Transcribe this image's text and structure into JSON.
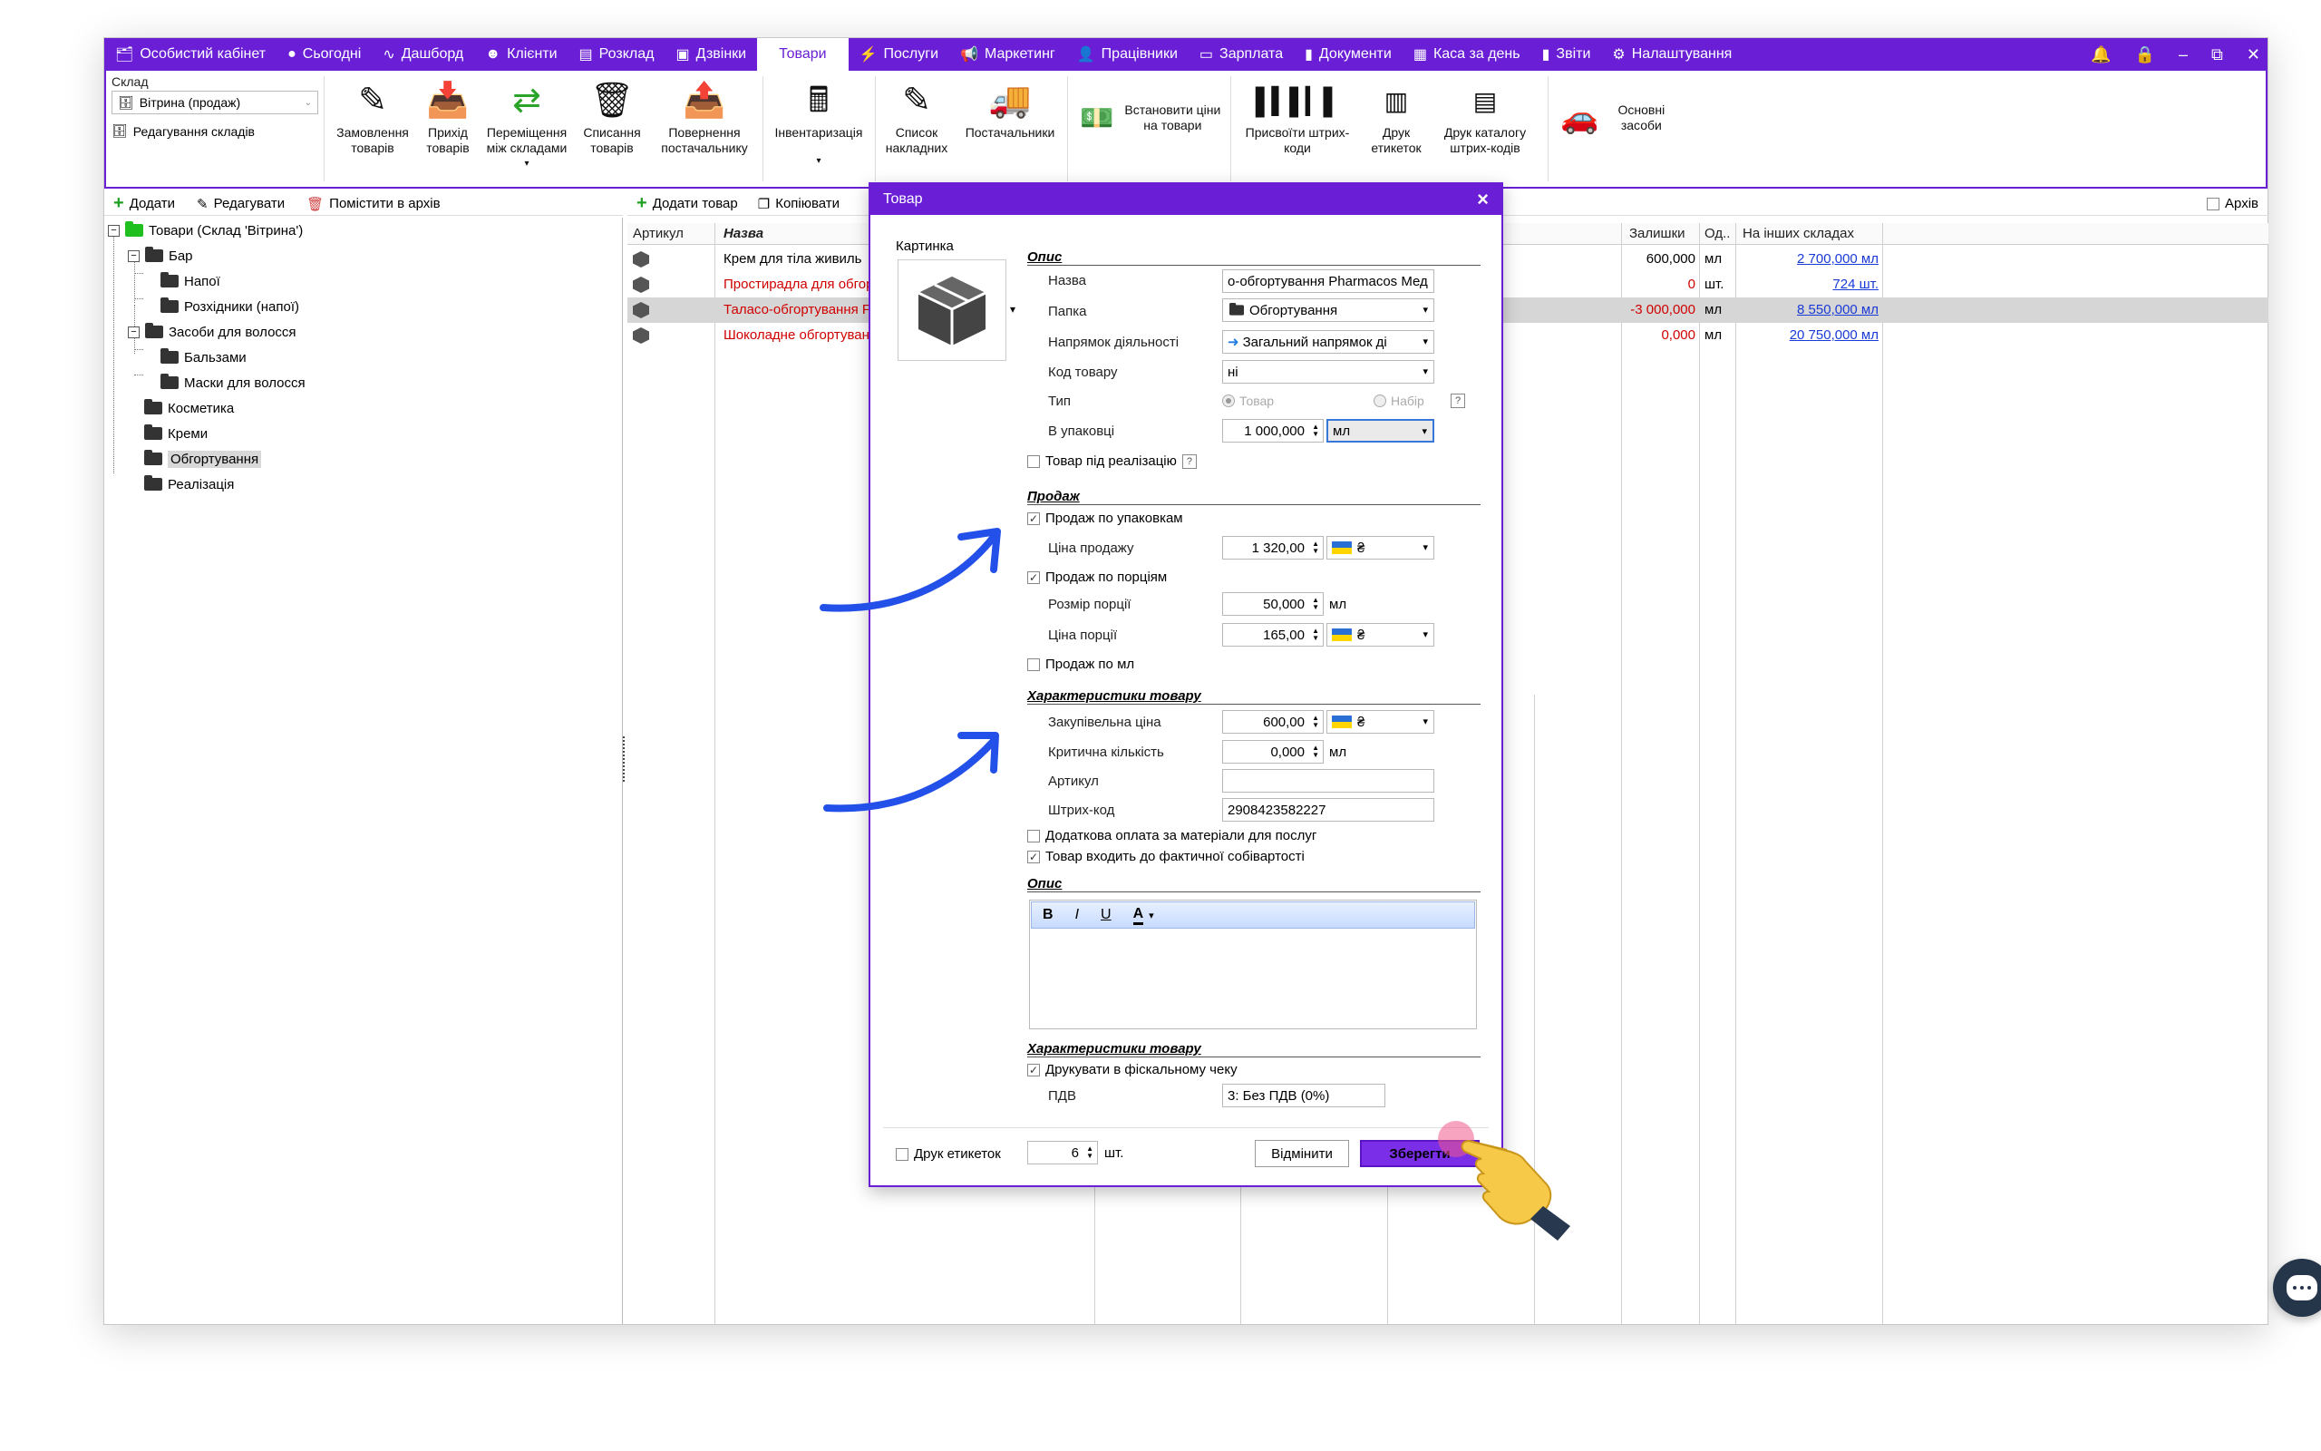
{
  "nav": {
    "items": [
      {
        "label": "Особистий кабінет",
        "icon": "🗂"
      },
      {
        "label": "Сьогодні",
        "icon": "●"
      },
      {
        "label": "Дашборд",
        "icon": "∿"
      },
      {
        "label": "Клієнти",
        "icon": "☻"
      },
      {
        "label": "Розклад",
        "icon": "▤"
      },
      {
        "label": "Дзвінки",
        "icon": "▣"
      },
      {
        "label": "Товари",
        "icon": ""
      },
      {
        "label": "Послуги",
        "icon": "⚡"
      },
      {
        "label": "Маркетинг",
        "icon": "📢"
      },
      {
        "label": "Працівники",
        "icon": "👤"
      },
      {
        "label": "Зарплата",
        "icon": "▭"
      },
      {
        "label": "Документи",
        "icon": "▮"
      },
      {
        "label": "Каса за день",
        "icon": "▦"
      },
      {
        "label": "Звіти",
        "icon": "▮"
      },
      {
        "label": "Налаштування",
        "icon": "⚙"
      }
    ],
    "active_index": 6
  },
  "ribbon": {
    "warehouse_label": "Склад",
    "warehouse_value": "Вітрина (продаж)",
    "edit_warehouses": "Редагування складів",
    "buttons": {
      "order": "Замовлення товарів",
      "receipt": "Прихід товарів",
      "transfer": "Переміщення між складами",
      "writeoff": "Списання товарів",
      "return": "Повернення постачальнику",
      "inventory": "Інвентаризація",
      "invoices": "Список накладних",
      "suppliers": "Постачальники",
      "set_prices": "Встановити ціни на товари",
      "assign_barcodes": "Присвоїти штрих-коди",
      "print_labels": "Друк етикеток",
      "print_catalog": "Друк каталогу штрих-кодів",
      "fixed_assets": "Основні засоби"
    }
  },
  "left_toolbar": {
    "add": "Додати",
    "edit": "Редагувати",
    "archive": "Помістити в архів"
  },
  "tree": {
    "root": "Товари (Склад 'Вітрина')",
    "bar": "Бар",
    "drinks": "Напої",
    "consumables": "Розхідники (напої)",
    "hair": "Засоби для волосся",
    "balms": "Бальзами",
    "masks": "Маски для волосся",
    "cosmetics": "Косметика",
    "creams": "Креми",
    "wraps": "Обгортування",
    "sales": "Реалізація"
  },
  "grid_toolbar": {
    "add_product": "Додати товар",
    "copy": "Копіювати",
    "archive": "Архів"
  },
  "grid": {
    "headers": {
      "article": "Артикул",
      "name": "Назва",
      "stock": "Залишки",
      "unit": "Од..",
      "other": "На інших складах"
    },
    "rows": [
      {
        "name": "Крем для тіла живиль",
        "stock": "600,000",
        "unit": "мл",
        "other": "2 700,000 мл",
        "red": false,
        "stock_red": false
      },
      {
        "name": "Простирадла для обгор",
        "stock": "0",
        "unit": "шт.",
        "other": "724 шт.",
        "red": true,
        "stock_red": true
      },
      {
        "name": "Таласо-обгортування F",
        "stock": "-3 000,000",
        "unit": "мл",
        "other": "8 550,000 мл",
        "red": true,
        "stock_red": true
      },
      {
        "name": "Шоколадне обгортуван",
        "stock": "0,000",
        "unit": "мл",
        "other": "20 750,000 мл",
        "red": true,
        "stock_red": true
      }
    ]
  },
  "dialog": {
    "title": "Товар",
    "picture_label": "Картинка",
    "section_desc": "Опис",
    "name_label": "Назва",
    "name_value": "о-обгортування Pharmacos Мед",
    "folder_label": "Папка",
    "folder_value": "Обгортування",
    "direction_label": "Напрямок діяльності",
    "direction_value": "Загальний напрямок ді",
    "code_label": "Код товару",
    "code_value": "ні",
    "type_label": "Тип",
    "type_product": "Товар",
    "type_set": "Набір",
    "pack_label": "В упаковці",
    "pack_value": "1 000,000",
    "pack_unit": "мл",
    "consignment_label": "Товар під реалізацію",
    "section_sale": "Продаж",
    "sale_by_pack": "Продаж по упаковкам",
    "sale_price_label": "Ціна продажу",
    "sale_price_value": "1 320,00",
    "currency": "₴",
    "sale_by_portion": "Продаж по порціям",
    "portion_size_label": "Розмір порції",
    "portion_size_value": "50,000",
    "portion_unit": "мл",
    "portion_price_label": "Ціна порції",
    "portion_price_value": "165,00",
    "sale_by_ml": "Продаж по мл",
    "section_chars": "Характеристики товару",
    "purchase_label": "Закупівельна ціна",
    "purchase_value": "600,00",
    "critical_label": "Критична кількість",
    "critical_value": "0,000",
    "critical_unit": "мл",
    "article_label": "Артикул",
    "article_value": "",
    "barcode_label": "Штрих-код",
    "barcode_value": "2908423582227",
    "extra_payment": "Додаткова оплата за матеріали для послуг",
    "in_cost": "Товар входить до фактичної собівартості",
    "section_desc2": "Опис",
    "rte_bold": "B",
    "rte_italic": "I",
    "rte_underline": "U",
    "rte_color": "A",
    "section_chars2": "Характеристики товару",
    "fiscal_print": "Друкувати в фіскальному чеку",
    "vat_label": "ПДВ",
    "vat_value": "3: Без ПДВ (0%)",
    "print_labels": "Друк етикеток",
    "labels_count": "6",
    "labels_unit": "шт.",
    "cancel": "Відмінити",
    "save": "Зберегти"
  },
  "colors": {
    "accent": "#6a1fd6",
    "arrow": "#2350e8",
    "link": "#1a3ad6",
    "negative": "#d00000"
  }
}
